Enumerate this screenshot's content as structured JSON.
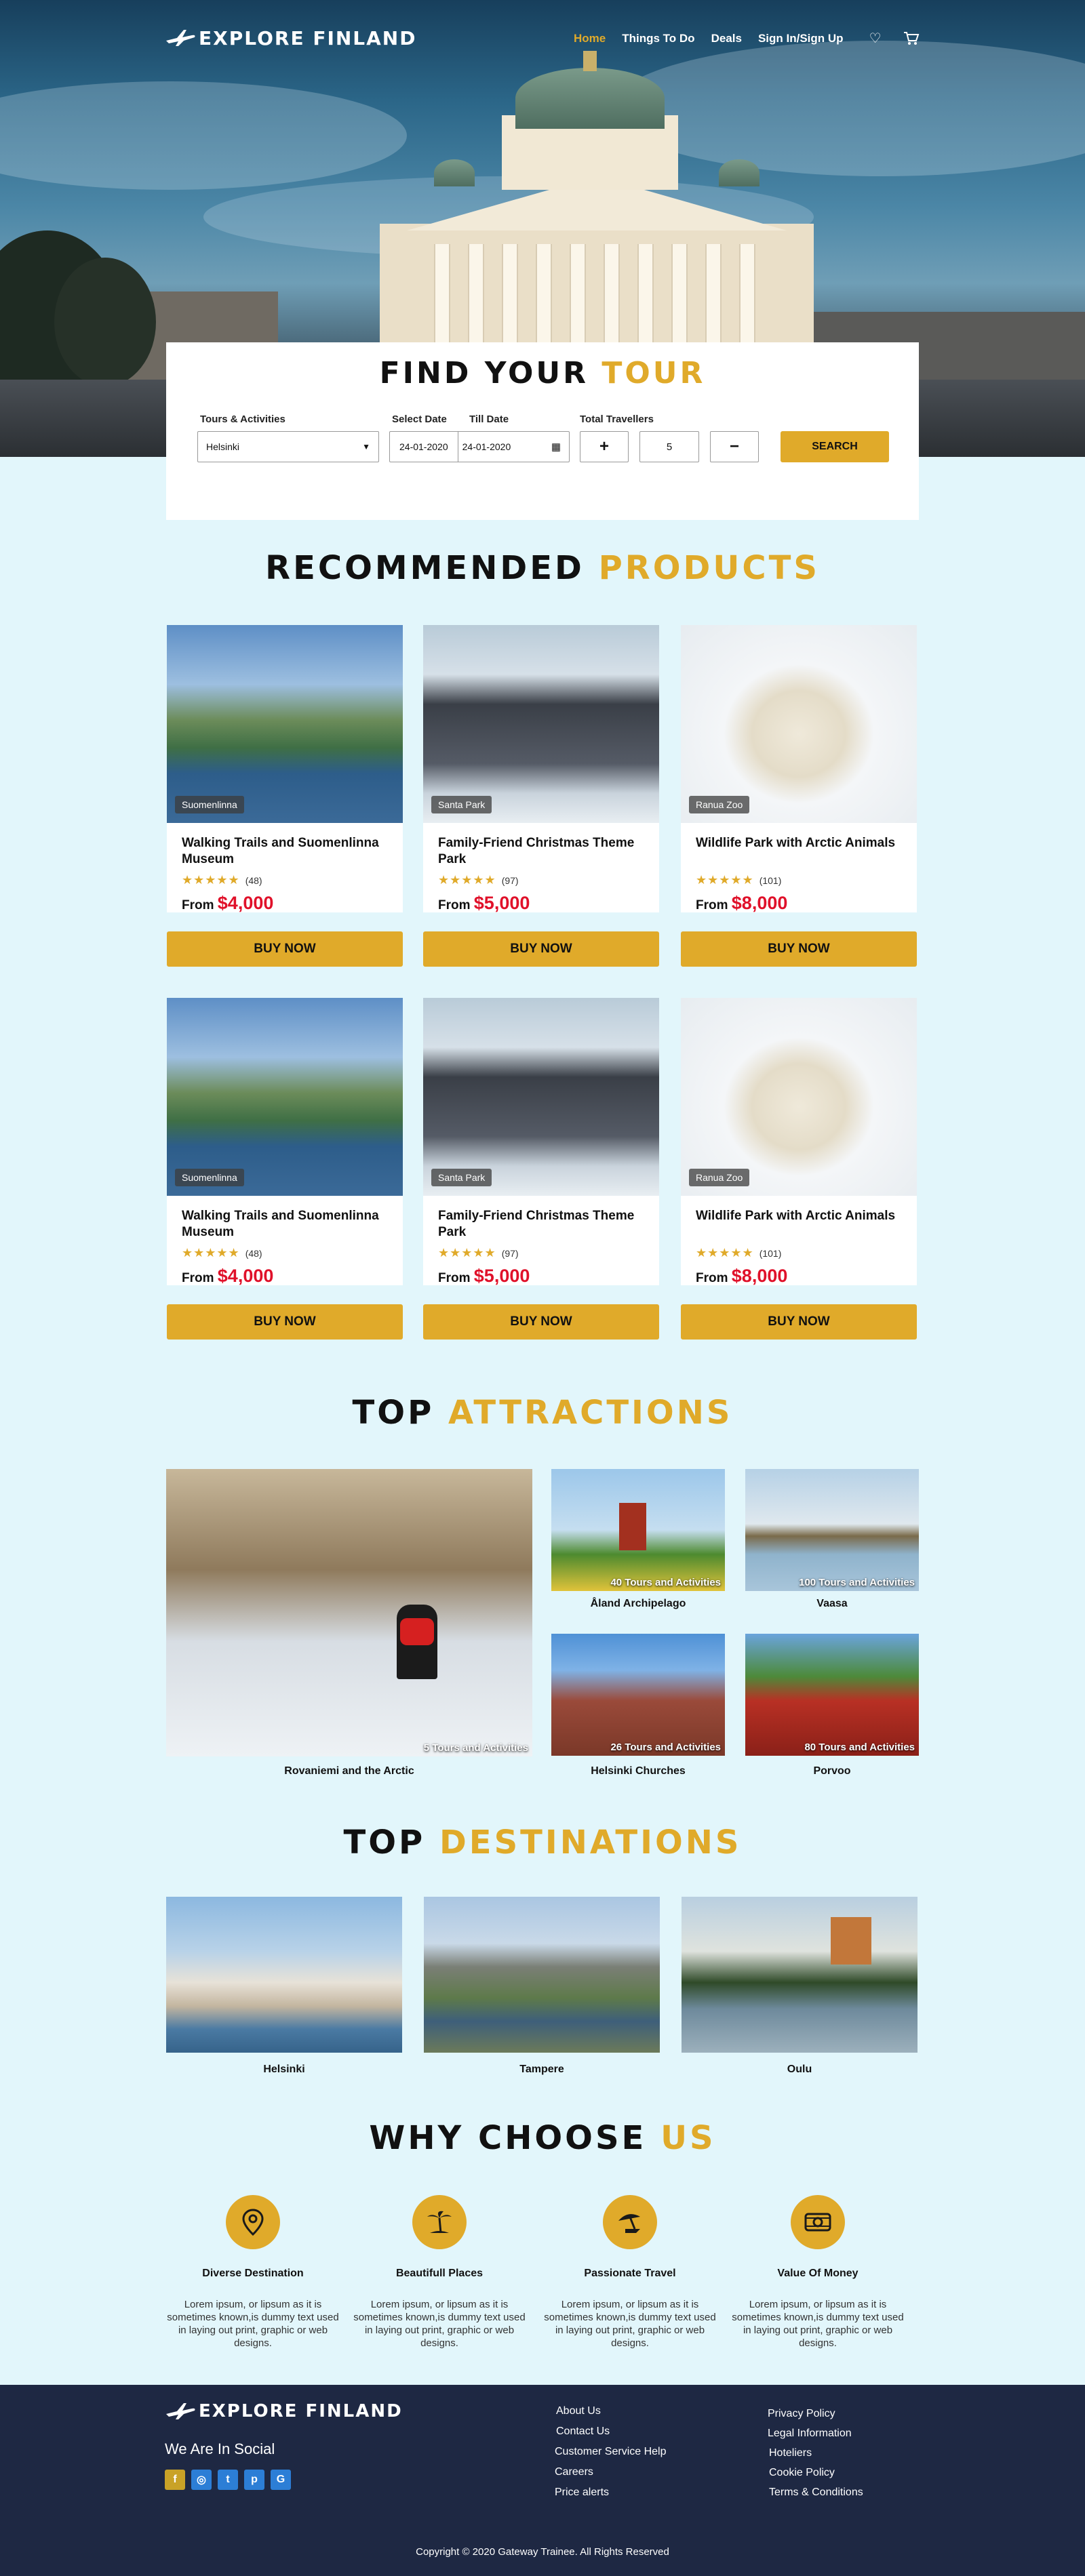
{
  "brand": {
    "name": "EXPLORE FINLAND"
  },
  "nav": {
    "items": [
      {
        "label": "Home",
        "active": true
      },
      {
        "label": "Things To Do"
      },
      {
        "label": "Deals"
      },
      {
        "label": "Sign In/Sign Up"
      }
    ],
    "icons": [
      "heart-icon",
      "cart-icon"
    ]
  },
  "search": {
    "title_main": "FIND YOUR",
    "title_accent": "TOUR",
    "tours_label": "Tours & Activities",
    "tours_value": "Helsinki",
    "select_date_label": "Select Date",
    "select_date_value": "24-01-2020",
    "till_date_label": "Till Date",
    "till_date_value": "24-01-2020",
    "travellers_label": "Total Travellers",
    "travellers_value": "5",
    "plus": "+",
    "minus": "−",
    "button": "SEARCH"
  },
  "recommended": {
    "title_main": "RECOMMENDED",
    "title_accent": "PRODUCTS",
    "from_label": "From",
    "buy_label": "BUY NOW",
    "products": [
      {
        "tag": "Suomenlinna",
        "title": "Walking Trails and Suomenlinna Museum",
        "rating": 4.5,
        "reviews": "(48)",
        "price": "$4,000"
      },
      {
        "tag": "Santa Park",
        "title": "Family-Friend Christmas Theme Park",
        "rating": 4.5,
        "reviews": "(97)",
        "price": "$5,000"
      },
      {
        "tag": "Ranua Zoo",
        "title": "Wildlife Park with Arctic Animals",
        "rating": 4.5,
        "reviews": "(101)",
        "price": "$8,000"
      },
      {
        "tag": "Suomenlinna",
        "title": "Walking Trails and Suomenlinna Museum",
        "rating": 4.5,
        "reviews": "(48)",
        "price": "$4,000"
      },
      {
        "tag": "Santa Park",
        "title": "Family-Friend Christmas Theme Park",
        "rating": 4.5,
        "reviews": "(97)",
        "price": "$5,000"
      },
      {
        "tag": "Ranua Zoo",
        "title": "Wildlife Park with Arctic Animals",
        "rating": 4.5,
        "reviews": "(101)",
        "price": "$8,000"
      }
    ]
  },
  "attractions": {
    "title_main": "TOP",
    "title_accent": "ATTRACTIONS",
    "items": [
      {
        "name": "Rovaniemi and the Arctic",
        "count": "5 Tours and Activities"
      },
      {
        "name": "Åland Archipelago",
        "count": "40 Tours and Activities"
      },
      {
        "name": "Vaasa",
        "count": "100 Tours and Activities"
      },
      {
        "name": "Helsinki Churches",
        "count": "26 Tours and Activities"
      },
      {
        "name": "Porvoo",
        "count": "80 Tours and Activities"
      }
    ]
  },
  "destinations": {
    "title_main": "TOP",
    "title_accent": "DESTINATIONS",
    "items": [
      {
        "name": "Helsinki"
      },
      {
        "name": "Tampere"
      },
      {
        "name": "Oulu"
      }
    ]
  },
  "why": {
    "title_main": "WHY CHOOSE",
    "title_accent": "US",
    "items": [
      {
        "icon": "map-pin-icon",
        "title": "Diverse Destination",
        "text": "Lorem ipsum, or lipsum as it is sometimes known,is dummy text used in laying out print, graphic or web designs."
      },
      {
        "icon": "palm-tree-icon",
        "title": "Beautifull Places",
        "text": "Lorem ipsum, or lipsum as it is sometimes known,is dummy text used in laying out print, graphic or web designs."
      },
      {
        "icon": "beach-umbrella-icon",
        "title": "Passionate Travel",
        "text": "Lorem ipsum, or lipsum as it is sometimes known,is dummy text used in laying out print, graphic or web designs."
      },
      {
        "icon": "money-icon",
        "title": "Value Of Money",
        "text": "Lorem ipsum, or lipsum as it is sometimes known,is dummy text used in laying out print, graphic or web designs."
      }
    ]
  },
  "footer": {
    "brand": "EXPLORE FINLAND",
    "social_title": "We Are In Social",
    "social": [
      "f",
      "◎",
      "t",
      "p",
      "G"
    ],
    "col1": [
      "About Us",
      "Contact Us",
      "Customer Service Help",
      "Careers",
      "Price alerts"
    ],
    "col2": [
      "Privacy Policy",
      "Legal Information",
      "Hoteliers",
      "Cookie Policy",
      "Terms & Conditions"
    ],
    "copyright": "Copyright © 2020 Gateway Trainee. All Rights Reserved"
  },
  "colors": {
    "accent": "#e0aa2a",
    "price": "#e0112a",
    "footer": "#1e2843",
    "background": "#e2f6fb"
  }
}
